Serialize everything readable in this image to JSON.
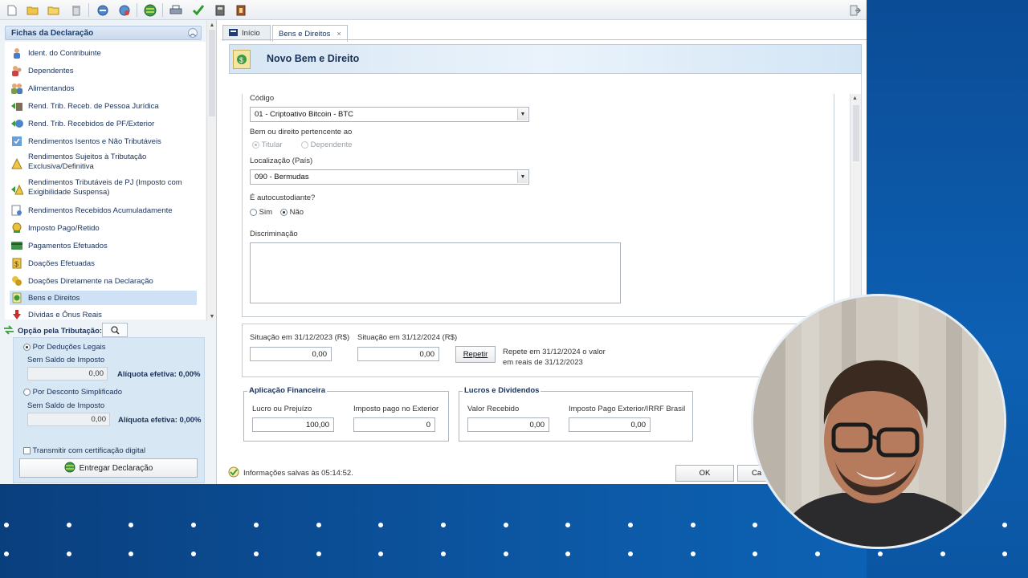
{
  "toolbar": {
    "icons": [
      "new-icon",
      "open-icon",
      "folder-icon",
      "delete-icon",
      "recover-icon",
      "internet-icon",
      "globe-icon",
      "print-icon",
      "check-icon",
      "calculator-icon",
      "book-icon",
      "exit-icon"
    ]
  },
  "sidebar": {
    "header": "Fichas da Declaração",
    "items": [
      {
        "label": "Ident. do Contribuinte",
        "icon": "person-icon"
      },
      {
        "label": "Dependentes",
        "icon": "dependents-icon"
      },
      {
        "label": "Alimentandos",
        "icon": "alimentandos-icon"
      },
      {
        "label": "Rend. Trib. Receb. de Pessoa Jurídica",
        "icon": "pj-income-icon"
      },
      {
        "label": "Rend. Trib. Recebidos de PF/Exterior",
        "icon": "pf-income-icon"
      },
      {
        "label": "Rendimentos Isentos e Não Tributáveis",
        "icon": "exempt-icon"
      },
      {
        "label": "Rendimentos Sujeitos à Tributação Exclusiva/Definitiva",
        "icon": "exclusive-tax-icon"
      },
      {
        "label": "Rendimentos Tributáveis de PJ (Imposto com Exigibilidade Suspensa)",
        "icon": "suspended-icon"
      },
      {
        "label": "Rendimentos Recebidos Acumuladamente",
        "icon": "accumulated-icon"
      },
      {
        "label": "Imposto Pago/Retido",
        "icon": "tax-paid-icon"
      },
      {
        "label": "Pagamentos Efetuados",
        "icon": "payments-icon"
      },
      {
        "label": "Doações Efetuadas",
        "icon": "donations-icon"
      },
      {
        "label": "Doações Diretamente na Declaração",
        "icon": "direct-donations-icon"
      },
      {
        "label": "Bens e Direitos",
        "icon": "assets-icon"
      },
      {
        "label": "Dívidas e Ônus Reais",
        "icon": "debts-icon"
      }
    ],
    "selected": "Bens e Direitos"
  },
  "opcao": {
    "title": "Opção pela Tributação:",
    "deducoes_label": "Por Deduções Legais",
    "saldo_label_1": "Sem Saldo de Imposto",
    "saldo_value_1": "0,00",
    "aliquota_1": "Alíquota efetiva: 0,00%",
    "simplificado_label": "Por Desconto Simplificado",
    "saldo_label_2": "Sem Saldo de Imposto",
    "saldo_value_2": "0,00",
    "aliquota_2": "Alíquota efetiva: 0,00%",
    "cert_label": "Transmitir com certificação digital",
    "entregar_label": "Entregar Declaração"
  },
  "tabs": [
    {
      "label": "Início"
    },
    {
      "label": "Bens e Direitos",
      "close": "×"
    }
  ],
  "form": {
    "title": "Novo Bem e Direito",
    "codigo_label": "Código",
    "codigo_value": "01 - Criptoativo Bitcoin - BTC",
    "pertencente_label": "Bem ou direito pertencente ao",
    "titular_label": "Titular",
    "dependente_label": "Dependente",
    "localizacao_label": "Localização (País)",
    "localizacao_value": "090 - Bermudas",
    "autocustodiante_label": "É autocustodiante?",
    "sim_label": "Sim",
    "nao_label": "Não",
    "discriminacao_label": "Discriminação",
    "discriminacao_value": "",
    "situacao_2023_label": "Situação em 31/12/2023 (R$)",
    "situacao_2023_value": "0,00",
    "situacao_2024_label": "Situação em 31/12/2024 (R$)",
    "situacao_2024_value": "0,00",
    "repetir_label": "Repetir",
    "repete_text_1": "Repete em 31/12/2024 o valor",
    "repete_text_2": "em reais de 31/12/2023",
    "aplicacao_legend": "Aplicação Financeira",
    "lucro_label": "Lucro ou Prejuízo",
    "lucro_value": "100,00",
    "imposto_exterior_label": "Imposto pago no Exterior",
    "imposto_exterior_value": "0",
    "lucros_legend": "Lucros e Dividendos",
    "valor_recebido_label": "Valor Recebido",
    "valor_recebido_value": "0,00",
    "imposto_irrf_label": "Imposto Pago Exterior/IRRF Brasil",
    "imposto_irrf_value": "0,00",
    "ok_label": "OK",
    "cancel_label": "Ca"
  },
  "status": {
    "text": "Informações salvas às 05:14:52."
  },
  "colors": {
    "accent": "#1a3157",
    "selected": "#cfe2f5",
    "background_blue": "#0c5aa8"
  }
}
